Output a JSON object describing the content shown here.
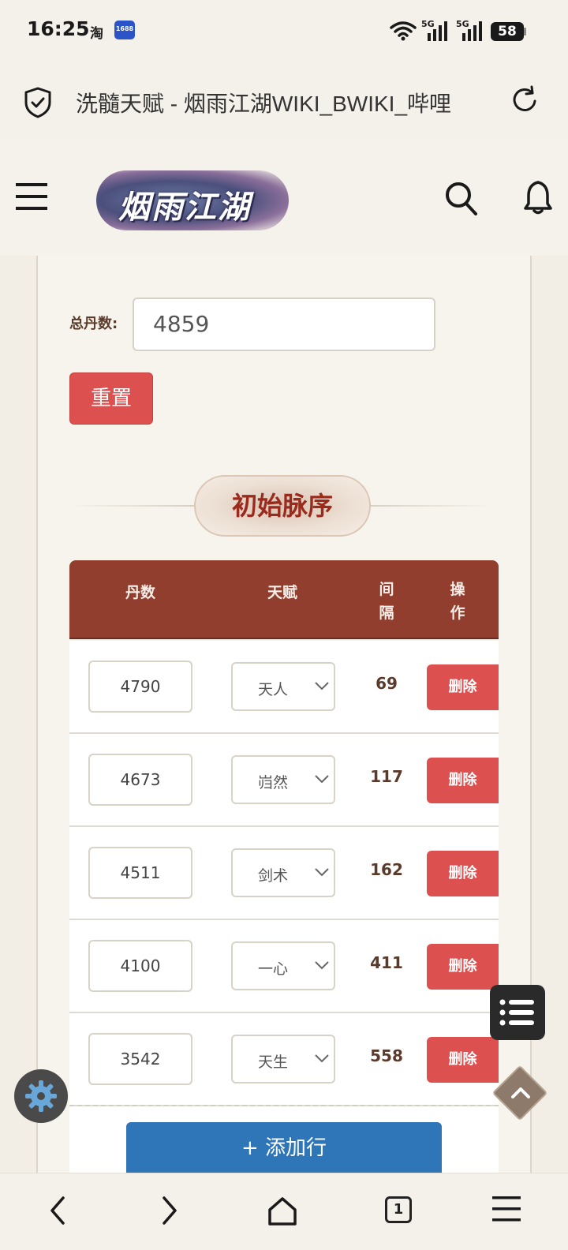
{
  "status_bar": {
    "time": "16:25",
    "app_icons": [
      "淘",
      "1688"
    ],
    "network": [
      "5G",
      "5G"
    ],
    "battery": "58"
  },
  "browser": {
    "page_title": "洗髓天赋 - 烟雨江湖WIKI_BWIKI_哔哩",
    "tab_count": "1"
  },
  "site": {
    "logo_text": "烟雨江湖"
  },
  "form": {
    "partial_heading": "",
    "total_label": "总丹数:",
    "total_value": "4859",
    "reset_label": "重置"
  },
  "section": {
    "title": "初始脉序"
  },
  "table": {
    "headers": {
      "dan": "丹数",
      "talent": "天赋",
      "interval": "间隔",
      "action": "操作"
    },
    "rows": [
      {
        "dan": "4790",
        "talent": "天人",
        "interval": "69",
        "action": "删除"
      },
      {
        "dan": "4673",
        "talent": "岿然",
        "interval": "117",
        "action": "删除"
      },
      {
        "dan": "4511",
        "talent": "剑术",
        "interval": "162",
        "action": "删除"
      },
      {
        "dan": "4100",
        "talent": "一心",
        "interval": "411",
        "action": "删除"
      },
      {
        "dan": "3542",
        "talent": "天生",
        "interval": "558",
        "action": "删除"
      }
    ],
    "add_row_label": "+ 添加行"
  },
  "icons": {
    "toc": "list-icon",
    "scroll_top": "chevron-up-icon",
    "settings": "gear-icon",
    "accent_red": "#dc5050",
    "header_brown": "#913e2e",
    "button_blue": "#2f76b8"
  }
}
